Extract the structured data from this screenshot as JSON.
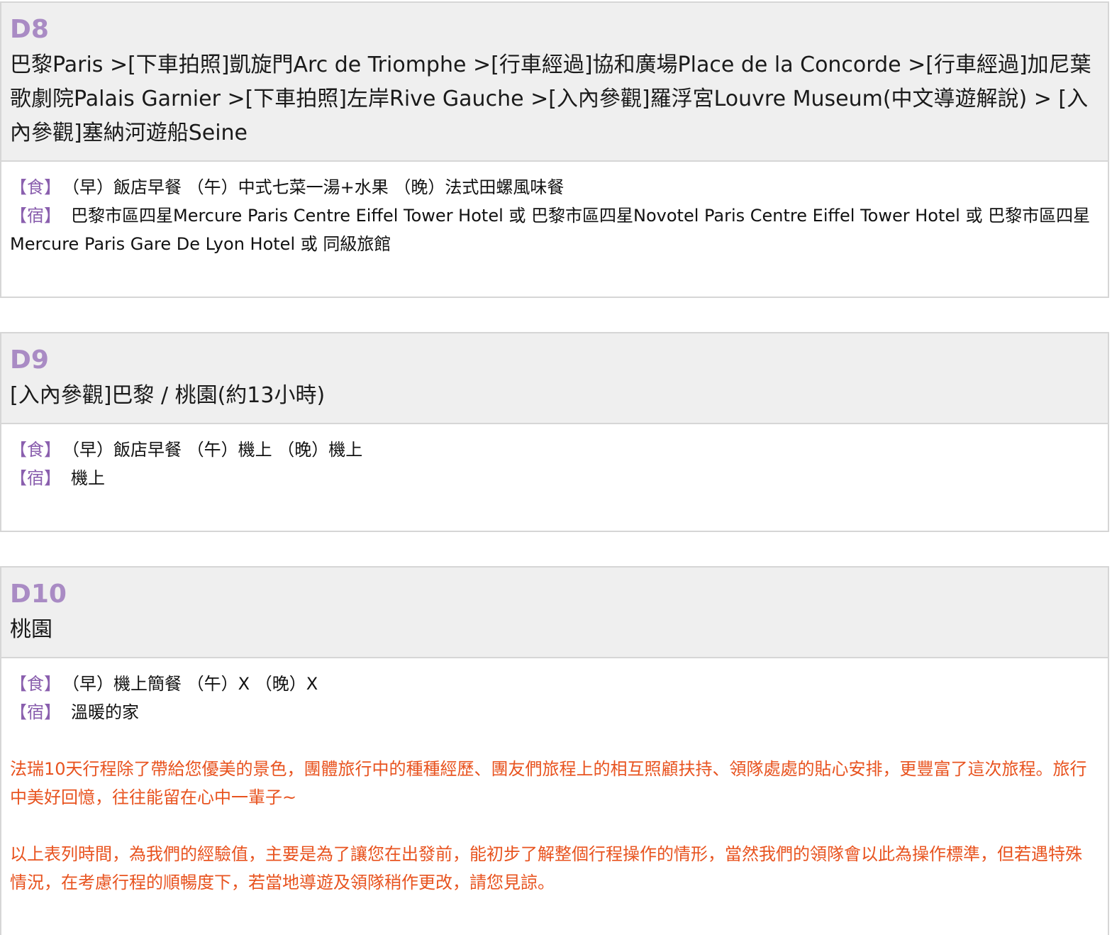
{
  "days": [
    {
      "label": "D8",
      "route": "巴黎Paris >[下車拍照]凱旋門Arc de Triomphe >[行車經過]協和廣場Place de la Concorde >[行車經過]加尼葉歌劇院Palais Garnier >[下車拍照]左岸Rive Gauche >[入內參觀]羅浮宮Louvre Museum(中文導遊解說) > [入內參觀]塞納河遊船Seine",
      "meal_tag": "【食】",
      "meals": "（早）飯店早餐 （午）中式七菜一湯+水果 （晚）法式田螺風味餐",
      "stay_tag": "【宿】",
      "stay": "巴黎市區四星Mercure Paris Centre Eiffel Tower Hotel 或 巴黎市區四星Novotel Paris Centre Eiffel Tower Hotel 或 巴黎市區四星Mercure Paris Gare De Lyon Hotel 或 同級旅館"
    },
    {
      "label": "D9",
      "route": "[入內參觀]巴黎 / 桃園(約13小時)",
      "meal_tag": "【食】",
      "meals": "（早）飯店早餐 （午）機上 （晚）機上",
      "stay_tag": "【宿】",
      "stay": "機上"
    },
    {
      "label": "D10",
      "route": "桃園",
      "meal_tag": "【食】",
      "meals": "（早）機上簡餐 （午）X （晚）X",
      "stay_tag": "【宿】",
      "stay": "溫暖的家"
    }
  ],
  "notes": [
    "法瑞10天行程除了帶給您優美的景色，團體旅行中的種種經歷、團友們旅程上的相互照顧扶持、領隊處處的貼心安排，更豐富了這次旅程。旅行中美好回憶，往往能留在心中一輩子~",
    "以上表列時間，為我們的經驗值，主要是為了讓您在出發前，能初步了解整個行程操作的情形，當然我們的領隊會以此為操作標準，但若遇特殊情況，在考慮行程的順暢度下，若當地導遊及領隊稍作更改，請您見諒。"
  ],
  "colors": {
    "day_label": "#a98bc4",
    "tag": "#8a5fae",
    "note": "#e8531f",
    "header_bg": "#efefef",
    "border": "#d6d6d6"
  }
}
